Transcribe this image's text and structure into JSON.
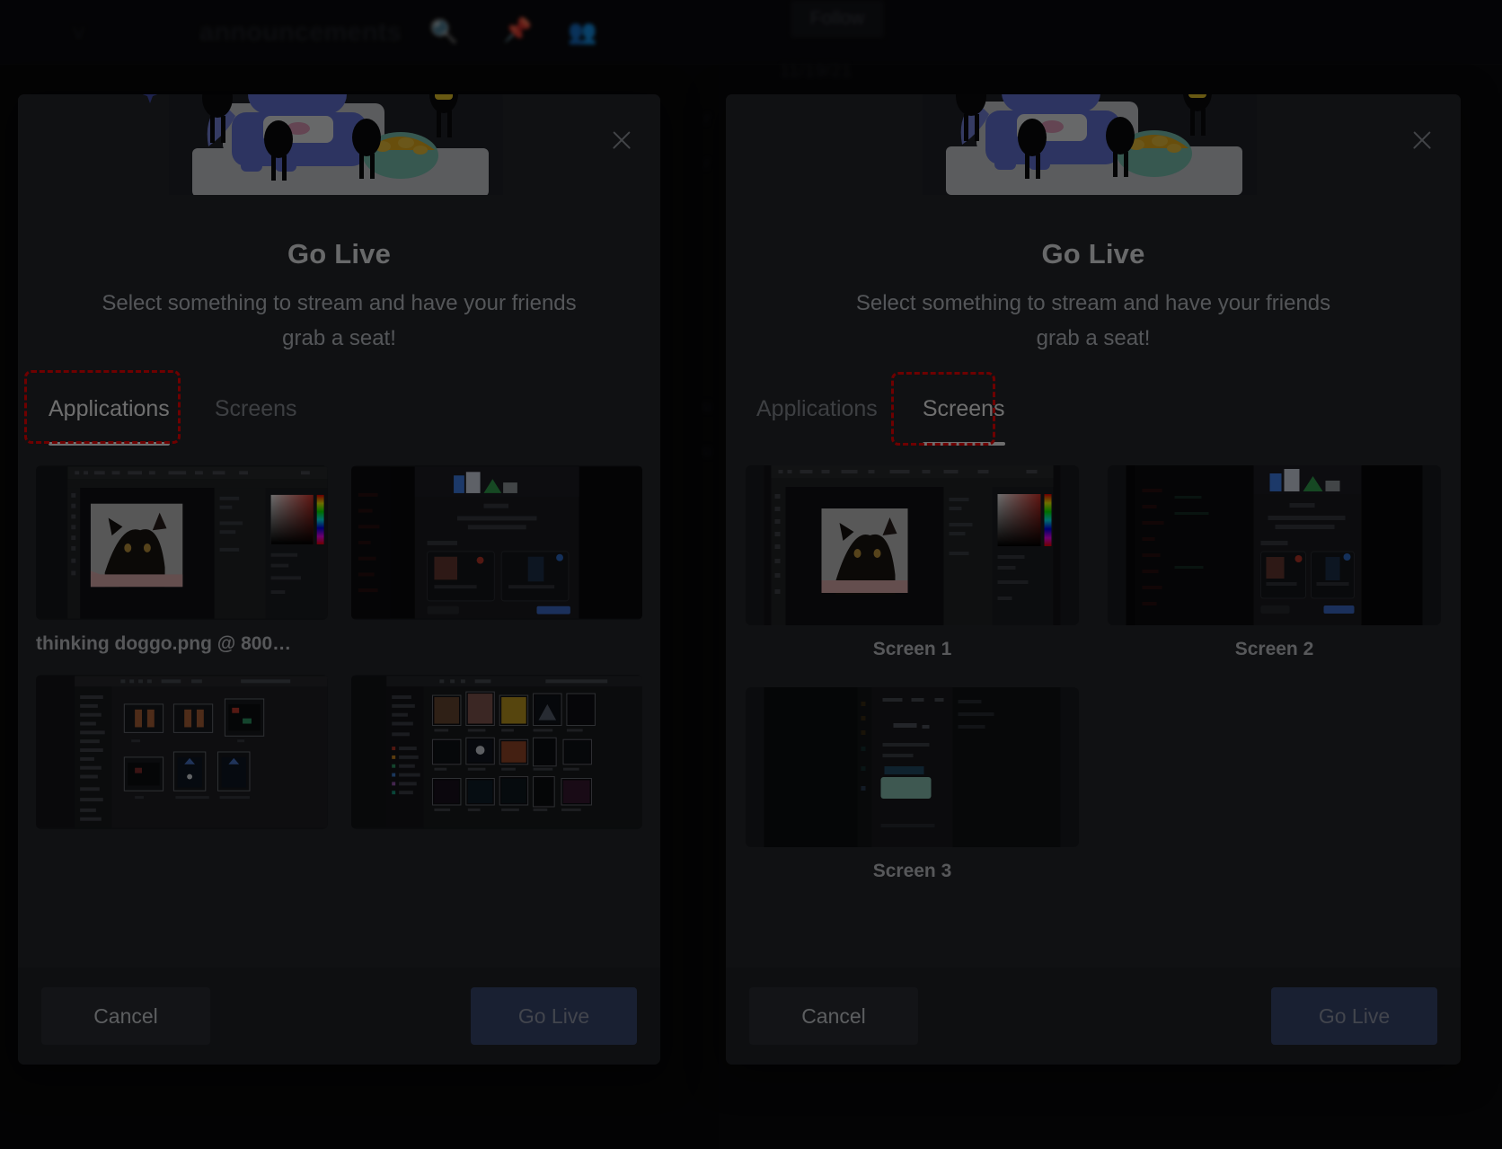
{
  "background": {
    "channel_title": "announcements",
    "follow_label": "Follow",
    "date_divider": "11/19/21",
    "icons": [
      "chevron-down-icon",
      "search-icon",
      "pin-icon",
      "members-icon",
      "sparkle-icon"
    ],
    "left_message_fragments": [
      "r",
      "r",
      "u",
      "u"
    ]
  },
  "dialogs": [
    {
      "id": "applications-dialog",
      "title": "Go Live",
      "subtitle": "Select something to stream and have your friends grab a seat!",
      "close_label": "close-icon",
      "tabs": [
        {
          "label": "Applications",
          "active": true
        },
        {
          "label": "Screens",
          "active": false
        }
      ],
      "items": [
        {
          "caption": "thinking doggo.png @ 800…",
          "kind": "image-editor"
        },
        {
          "caption": "",
          "kind": "browser-dark"
        },
        {
          "caption": "",
          "kind": "file-manager"
        },
        {
          "caption": "",
          "kind": "gallery"
        }
      ],
      "buttons": {
        "cancel": "Cancel",
        "primary": "Go Live"
      },
      "primary_disabled": true
    },
    {
      "id": "screens-dialog",
      "title": "Go Live",
      "subtitle": "Select something to stream and have your friends grab a seat!",
      "close_label": "close-icon",
      "tabs": [
        {
          "label": "Applications",
          "active": false
        },
        {
          "label": "Screens",
          "active": true
        }
      ],
      "items": [
        {
          "caption": "Screen 1",
          "kind": "image-editor"
        },
        {
          "caption": "Screen 2",
          "kind": "browser-dark"
        },
        {
          "caption": "Screen 3",
          "kind": "chat-screen"
        }
      ],
      "buttons": {
        "cancel": "Cancel",
        "primary": "Go Live"
      },
      "primary_disabled": true
    }
  ],
  "annotations": [
    {
      "target": "tab-applications",
      "color": "#ff0000",
      "style": "dashed"
    },
    {
      "target": "tab-screens",
      "color": "#ff0000",
      "style": "dashed"
    }
  ],
  "colors": {
    "modal_bg": "#26282d",
    "footer_bg": "#212429",
    "primary_button": "#3b4a75",
    "cancel_button": "#2d3036",
    "accent_text": "#ffffff",
    "muted_text": "#8d9299",
    "annotation": "#ff0000",
    "brand_blurple": "#5865f2"
  }
}
